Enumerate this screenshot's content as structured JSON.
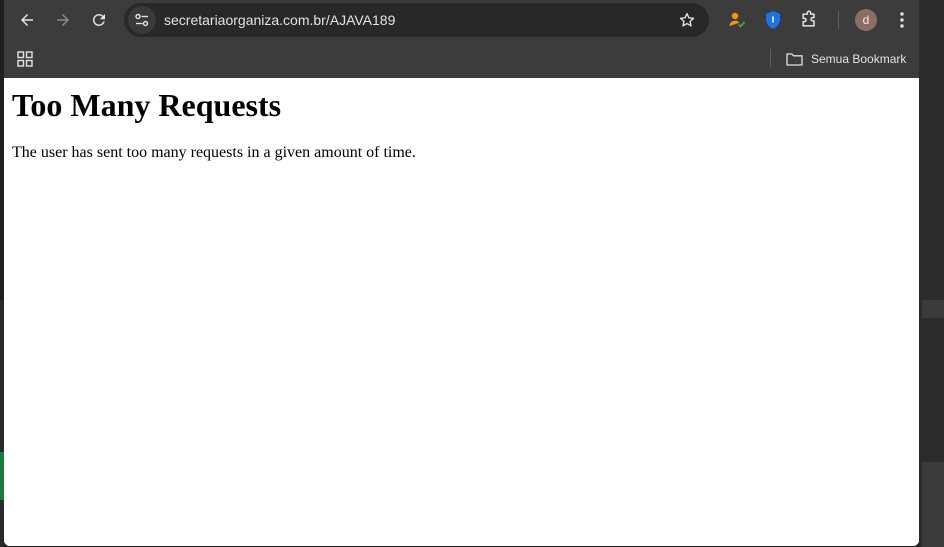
{
  "browser": {
    "url": "secretariaorganiza.com.br/AJAVA189",
    "icons": {
      "back": "back-arrow-icon",
      "forward": "forward-arrow-icon",
      "reload": "reload-icon",
      "site_info": "tune-icon",
      "bookmark_star": "star-icon",
      "extension_1": "person-check-icon",
      "extension_2": "shield-icon",
      "extensions_menu": "puzzle-icon",
      "menu": "more-vertical-icon",
      "apps": "apps-grid-icon",
      "folder": "folder-icon"
    },
    "profile_initial": "d",
    "bookmarks_bar": {
      "all_bookmarks_label": "Semua Bookmark"
    }
  },
  "page": {
    "heading": "Too Many Requests",
    "message": "The user has sent too many requests in a given amount of time."
  },
  "colors": {
    "toolbar": "#3c3c3c",
    "omnibox": "#282828",
    "shield_extension": "#1a73e8",
    "avatar": "#8d6e63"
  }
}
